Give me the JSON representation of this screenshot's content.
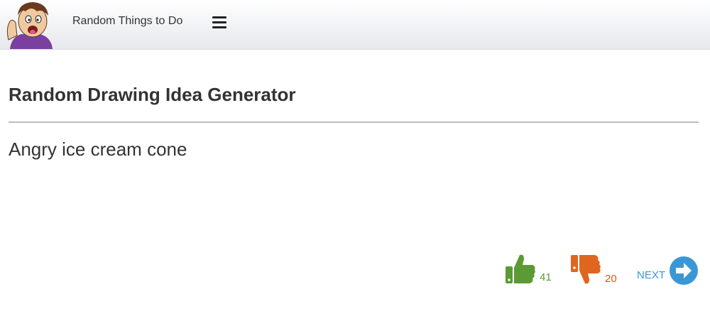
{
  "header": {
    "site_title": "Random Things to Do",
    "logo_icon": "cartoon-avatar-logo",
    "menu_icon": "hamburger-menu-icon"
  },
  "main": {
    "title": "Random Drawing Idea Generator",
    "idea": "Angry ice cream cone"
  },
  "actions": {
    "upvote_count": "41",
    "downvote_count": "20",
    "next_label": "NEXT",
    "colors": {
      "upvote": "#5b9a34",
      "downvote": "#e0661f",
      "next": "#3a97d6"
    }
  }
}
